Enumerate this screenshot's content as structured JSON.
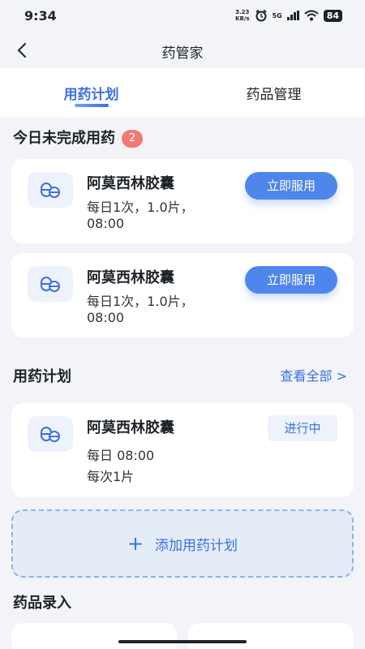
{
  "status_bar": {
    "time": "9:34",
    "net_speed_value": "3.23",
    "net_speed_unit": "KB/s",
    "network": "5G",
    "battery": "84"
  },
  "header": {
    "title": "药管家"
  },
  "tabs": [
    {
      "label": "用药计划",
      "active": true
    },
    {
      "label": "药品管理",
      "active": false
    }
  ],
  "pending": {
    "title": "今日未完成用药",
    "count": "2",
    "items": [
      {
        "name": "阿莫西林胶囊",
        "line1": "每日1次，1.0片，",
        "line2": "08:00",
        "action": "立即服用"
      },
      {
        "name": "阿莫西林胶囊",
        "line1": "每日1次，1.0片，",
        "line2": "08:00",
        "action": "立即服用"
      }
    ]
  },
  "plans": {
    "title": "用药计划",
    "view_all": "查看全部 >",
    "items": [
      {
        "name": "阿莫西林胶囊",
        "schedule": "每日 08:00",
        "dose": "每次1片",
        "status": "进行中"
      }
    ],
    "add_label": "添加用药计划"
  },
  "entry": {
    "title": "药品录入"
  },
  "colors": {
    "accent": "#3b6fe0",
    "button": "#4f86ec",
    "badge": "#f27a72",
    "background": "#f2f4f7"
  }
}
